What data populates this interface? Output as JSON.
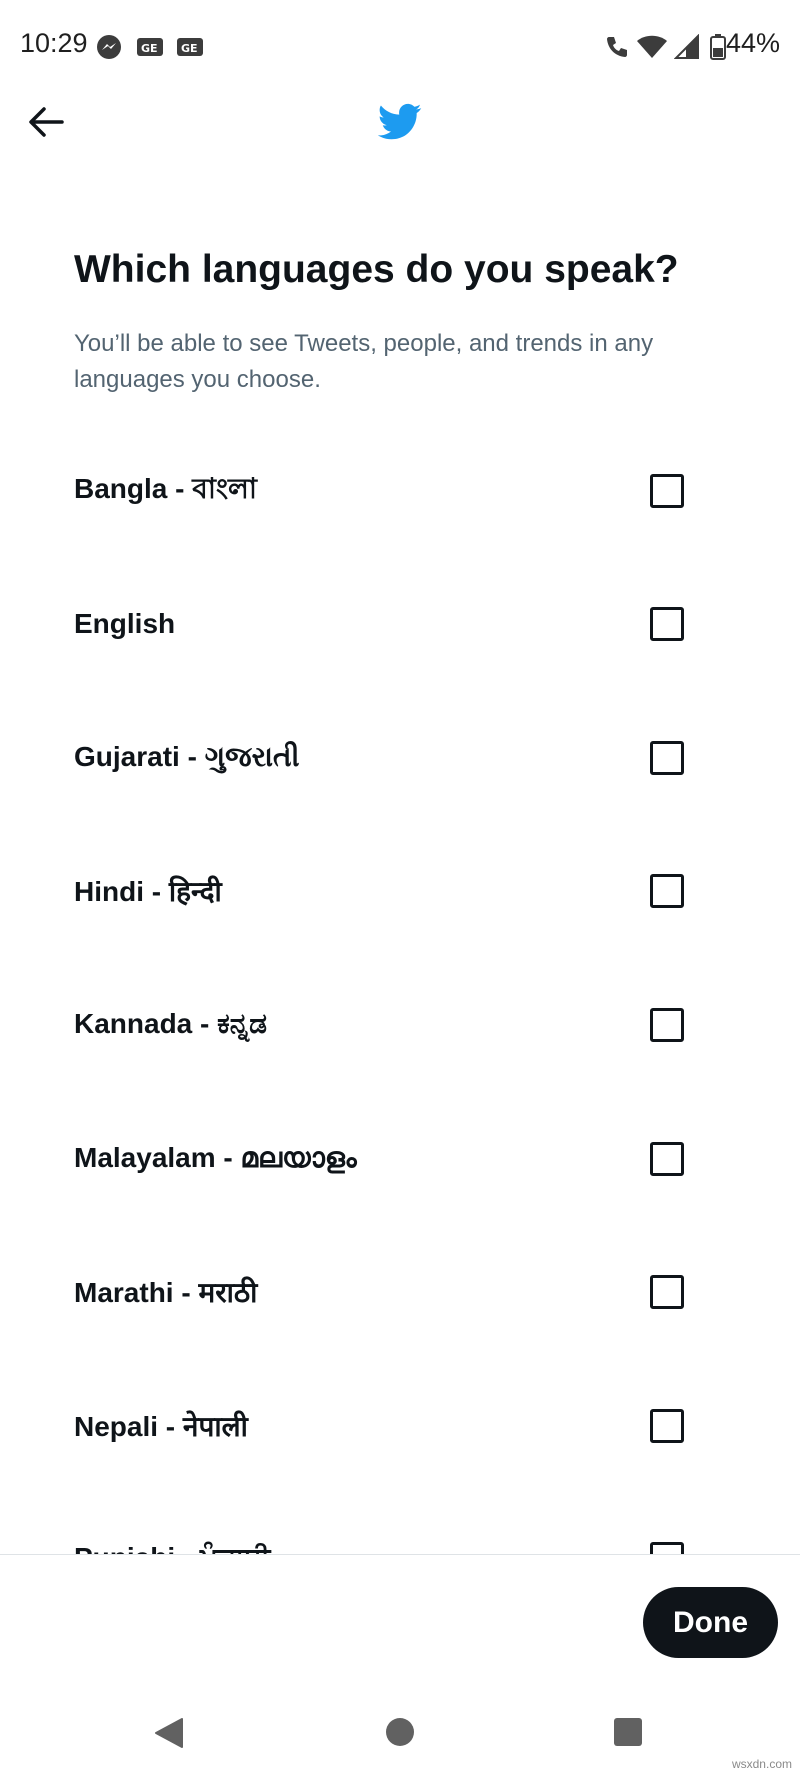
{
  "status_bar": {
    "time": "10:29",
    "battery": "44%",
    "icons": [
      "messenger-icon",
      "ge-notification-icon",
      "ge-notification-icon",
      "wifi-call-icon",
      "wifi-icon",
      "cell-signal-icon",
      "battery-icon"
    ]
  },
  "header": {
    "back_icon": "arrow-left-icon",
    "logo_icon": "twitter-bird-icon",
    "brand_color": "#1d9bf0"
  },
  "page": {
    "title": "Which languages do you speak?",
    "subtitle": "You’ll be able to see Tweets, people, and trends in any languages you choose."
  },
  "languages": [
    {
      "label": "Bangla - বাংলা",
      "checked": false
    },
    {
      "label": "English",
      "checked": false
    },
    {
      "label": "Gujarati - ગુજરાતી",
      "checked": false
    },
    {
      "label": "Hindi - हिन्दी",
      "checked": false
    },
    {
      "label": "Kannada - ಕನ್ನಡ",
      "checked": false
    },
    {
      "label": "Malayalam - മലയാളം",
      "checked": false
    },
    {
      "label": "Marathi - मराठी",
      "checked": false
    },
    {
      "label": "Nepali - नेपाली",
      "checked": false
    },
    {
      "label": "Punjabi - ਪੰਜਾਬੀ",
      "checked": false
    }
  ],
  "footer": {
    "done_label": "Done"
  },
  "watermark": "wsxdn.com"
}
